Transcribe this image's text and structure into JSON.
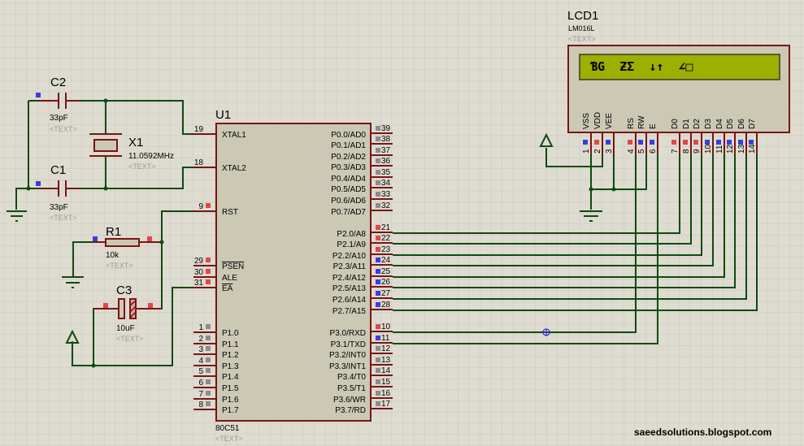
{
  "colors": {
    "background": "#dedcd0",
    "grid": "#c9c7bb",
    "wire": "#0f4a12",
    "component_border": "#7a1414",
    "component_fill": "#cbc8b4",
    "lcd_screen": "#9bb000",
    "pin_high": "#e04848",
    "pin_low": "#3c3ce0",
    "pin_floating": "#8c8c8c"
  },
  "placeholder_text": "<TEXT>",
  "u1": {
    "ref": "U1",
    "part": "80C51",
    "left_pins": [
      {
        "num": "19",
        "label": "XTAL1",
        "state": "none"
      },
      {
        "num": "18",
        "label": "XTAL2",
        "state": "none"
      },
      {
        "num": "9",
        "label": "RST",
        "state": "high"
      },
      {
        "num": "29",
        "label": "PSEN",
        "state": "high",
        "overline": true
      },
      {
        "num": "30",
        "label": "ALE",
        "state": "high"
      },
      {
        "num": "31",
        "label": "EA",
        "state": "high",
        "overline": true
      },
      {
        "num": "1",
        "label": "P1.0",
        "state": "floating"
      },
      {
        "num": "2",
        "label": "P1.1",
        "state": "floating"
      },
      {
        "num": "3",
        "label": "P1.2",
        "state": "floating"
      },
      {
        "num": "4",
        "label": "P1.3",
        "state": "floating"
      },
      {
        "num": "5",
        "label": "P1.4",
        "state": "floating"
      },
      {
        "num": "6",
        "label": "P1.5",
        "state": "floating"
      },
      {
        "num": "7",
        "label": "P1.6",
        "state": "floating"
      },
      {
        "num": "8",
        "label": "P1.7",
        "state": "floating"
      }
    ],
    "right_pins": [
      {
        "num": "39",
        "label": "P0.0/AD0",
        "state": "floating"
      },
      {
        "num": "38",
        "label": "P0.1/AD1",
        "state": "floating"
      },
      {
        "num": "37",
        "label": "P0.2/AD2",
        "state": "floating"
      },
      {
        "num": "36",
        "label": "P0.3/AD3",
        "state": "floating"
      },
      {
        "num": "35",
        "label": "P0.4/AD4",
        "state": "floating"
      },
      {
        "num": "34",
        "label": "P0.5/AD5",
        "state": "floating"
      },
      {
        "num": "33",
        "label": "P0.6/AD6",
        "state": "floating"
      },
      {
        "num": "32",
        "label": "P0.7/AD7",
        "state": "floating"
      },
      {
        "num": "21",
        "label": "P2.0/A8",
        "state": "high"
      },
      {
        "num": "22",
        "label": "P2.1/A9",
        "state": "high"
      },
      {
        "num": "23",
        "label": "P2.2/A10",
        "state": "high"
      },
      {
        "num": "24",
        "label": "P2.3/A11",
        "state": "low"
      },
      {
        "num": "25",
        "label": "P2.4/A12",
        "state": "low"
      },
      {
        "num": "26",
        "label": "P2.5/A13",
        "state": "low"
      },
      {
        "num": "27",
        "label": "P2.6/A14",
        "state": "low"
      },
      {
        "num": "28",
        "label": "P2.7/A15",
        "state": "low"
      },
      {
        "num": "10",
        "label": "P3.0/RXD",
        "state": "high"
      },
      {
        "num": "11",
        "label": "P3.1/TXD",
        "state": "low"
      },
      {
        "num": "12",
        "label": "P3.2/INT0",
        "state": "floating"
      },
      {
        "num": "13",
        "label": "P3.3/INT1",
        "state": "floating"
      },
      {
        "num": "14",
        "label": "P3.4/T0",
        "state": "floating"
      },
      {
        "num": "15",
        "label": "P3.5/T1",
        "state": "floating"
      },
      {
        "num": "16",
        "label": "P3.6/WR",
        "state": "floating"
      },
      {
        "num": "17",
        "label": "P3.7/RD",
        "state": "floating"
      }
    ]
  },
  "lcd": {
    "ref": "LCD1",
    "part": "LM016L",
    "display_line1": "ƁG  ƵƩ  ↓↑  ∠□",
    "display_line2": "",
    "pins": [
      {
        "num": "1",
        "label": "VSS",
        "state": "low"
      },
      {
        "num": "2",
        "label": "VDD",
        "state": "high"
      },
      {
        "num": "3",
        "label": "VEE",
        "state": "low"
      },
      {
        "num": "4",
        "label": "RS",
        "state": "high"
      },
      {
        "num": "5",
        "label": "RW",
        "state": "low"
      },
      {
        "num": "6",
        "label": "E",
        "state": "low"
      },
      {
        "num": "7",
        "label": "D0",
        "state": "high"
      },
      {
        "num": "8",
        "label": "D1",
        "state": "high"
      },
      {
        "num": "9",
        "label": "D2",
        "state": "high"
      },
      {
        "num": "10",
        "label": "D3",
        "state": "low"
      },
      {
        "num": "11",
        "label": "D4",
        "state": "low"
      },
      {
        "num": "12",
        "label": "D5",
        "state": "low"
      },
      {
        "num": "13",
        "label": "D6",
        "state": "low"
      },
      {
        "num": "14",
        "label": "D7",
        "state": "low"
      }
    ]
  },
  "components": {
    "c1": {
      "ref": "C1",
      "value": "33pF"
    },
    "c2": {
      "ref": "C2",
      "value": "33pF"
    },
    "c3": {
      "ref": "C3",
      "value": "10uF"
    },
    "x1": {
      "ref": "X1",
      "value": "11.0592MHz"
    },
    "r1": {
      "ref": "R1",
      "value": "10k"
    }
  },
  "watermark": "saeedsolutions.blogspot.com"
}
